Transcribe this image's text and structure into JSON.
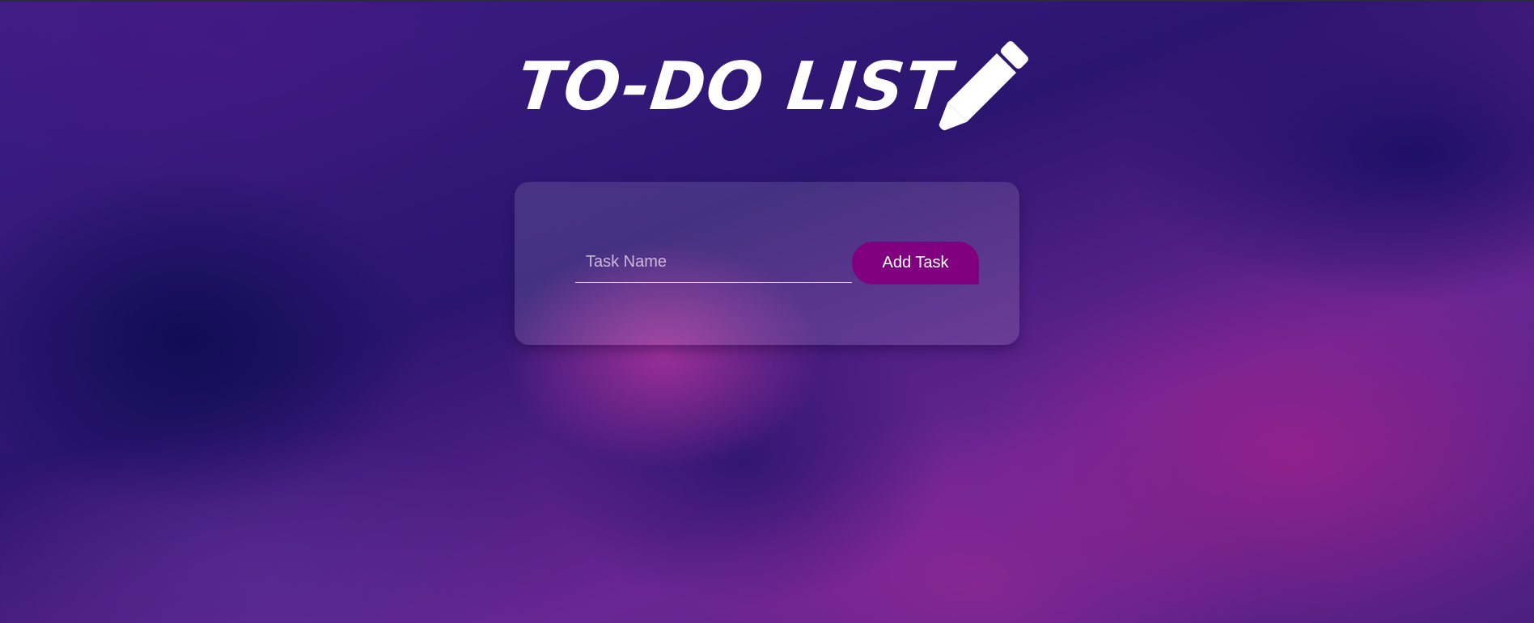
{
  "header": {
    "title": "TO-DO LIST",
    "icon": "pencil-icon"
  },
  "form": {
    "task_input": {
      "placeholder": "Task Name",
      "value": ""
    },
    "add_button_label": "Add Task"
  },
  "colors": {
    "button": "#800080",
    "text": "#ffffff"
  }
}
